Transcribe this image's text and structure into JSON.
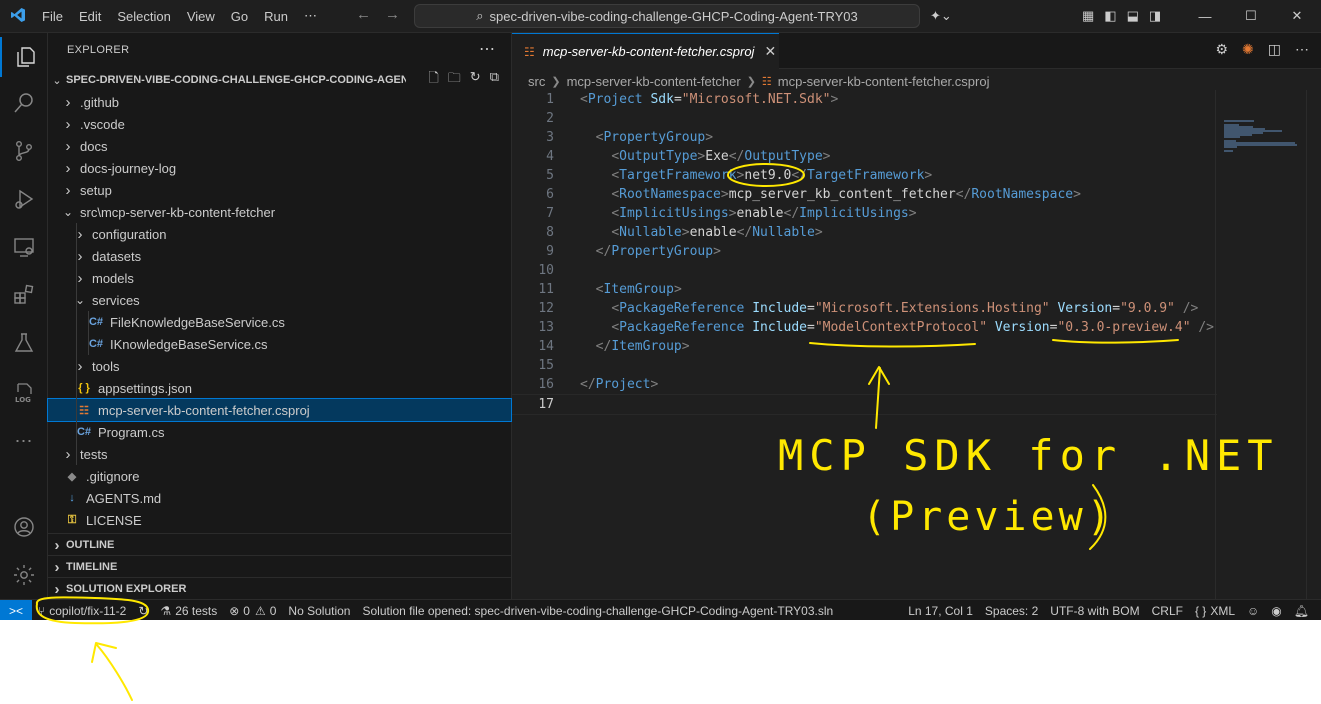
{
  "window": {
    "menu": [
      "File",
      "Edit",
      "Selection",
      "View",
      "Go",
      "Run",
      "⋯"
    ],
    "search": "spec-driven-vibe-coding-challenge-GHCP-Coding-Agent-TRY03"
  },
  "sidebar": {
    "title": "EXPLORER",
    "root": "SPEC-DRIVEN-VIBE-CODING-CHALLENGE-GHCP-CODING-AGEN...",
    "tree": [
      {
        "label": ".github",
        "kind": "folder",
        "indent": 0
      },
      {
        "label": ".vscode",
        "kind": "folder",
        "indent": 0
      },
      {
        "label": "docs",
        "kind": "folder",
        "indent": 0
      },
      {
        "label": "docs-journey-log",
        "kind": "folder",
        "indent": 0
      },
      {
        "label": "setup",
        "kind": "folder",
        "indent": 0
      },
      {
        "label": "src\\mcp-server-kb-content-fetcher",
        "kind": "folder-open",
        "indent": 0
      },
      {
        "label": "configuration",
        "kind": "folder",
        "indent": 1
      },
      {
        "label": "datasets",
        "kind": "folder",
        "indent": 1
      },
      {
        "label": "models",
        "kind": "folder",
        "indent": 1
      },
      {
        "label": "services",
        "kind": "folder-open",
        "indent": 1
      },
      {
        "label": "FileKnowledgeBaseService.cs",
        "kind": "cs",
        "indent": 2
      },
      {
        "label": "IKnowledgeBaseService.cs",
        "kind": "cs",
        "indent": 2
      },
      {
        "label": "tools",
        "kind": "folder",
        "indent": 1
      },
      {
        "label": "appsettings.json",
        "kind": "json",
        "indent": 1
      },
      {
        "label": "mcp-server-kb-content-fetcher.csproj",
        "kind": "rss",
        "indent": 1,
        "selected": true
      },
      {
        "label": "Program.cs",
        "kind": "cs",
        "indent": 1
      },
      {
        "label": "tests",
        "kind": "folder",
        "indent": 0
      },
      {
        "label": ".gitignore",
        "kind": "git",
        "indent": 0
      },
      {
        "label": "AGENTS.md",
        "kind": "md",
        "indent": 0
      },
      {
        "label": "LICENSE",
        "kind": "license",
        "indent": 0
      }
    ],
    "sections": [
      "OUTLINE",
      "TIMELINE",
      "SOLUTION EXPLORER"
    ]
  },
  "editor": {
    "tab": "mcp-server-kb-content-fetcher.csproj",
    "breadcrumbs": [
      "src",
      "mcp-server-kb-content-fetcher",
      "mcp-server-kb-content-fetcher.csproj"
    ],
    "cursor_line": 17,
    "lines": [
      [
        [
          "b",
          "<"
        ],
        [
          "tag",
          "Project"
        ],
        [
          "txt",
          " "
        ],
        [
          "attr",
          "Sdk"
        ],
        [
          "txt",
          "="
        ],
        [
          "str",
          "\"Microsoft.NET.Sdk\""
        ],
        [
          "b",
          ">"
        ]
      ],
      [],
      [
        [
          "txt",
          "  "
        ],
        [
          "b",
          "<"
        ],
        [
          "tag",
          "PropertyGroup"
        ],
        [
          "b",
          ">"
        ]
      ],
      [
        [
          "txt",
          "    "
        ],
        [
          "b",
          "<"
        ],
        [
          "tag",
          "OutputType"
        ],
        [
          "b",
          ">"
        ],
        [
          "txt",
          "Exe"
        ],
        [
          "b",
          "</"
        ],
        [
          "tag",
          "OutputType"
        ],
        [
          "b",
          ">"
        ]
      ],
      [
        [
          "txt",
          "    "
        ],
        [
          "b",
          "<"
        ],
        [
          "tag",
          "TargetFramework"
        ],
        [
          "b",
          ">"
        ],
        [
          "txt",
          "net9.0"
        ],
        [
          "b",
          "</"
        ],
        [
          "tag",
          "TargetFramework"
        ],
        [
          "b",
          ">"
        ]
      ],
      [
        [
          "txt",
          "    "
        ],
        [
          "b",
          "<"
        ],
        [
          "tag",
          "RootNamespace"
        ],
        [
          "b",
          ">"
        ],
        [
          "txt",
          "mcp_server_kb_content_fetcher"
        ],
        [
          "b",
          "</"
        ],
        [
          "tag",
          "RootNamespace"
        ],
        [
          "b",
          ">"
        ]
      ],
      [
        [
          "txt",
          "    "
        ],
        [
          "b",
          "<"
        ],
        [
          "tag",
          "ImplicitUsings"
        ],
        [
          "b",
          ">"
        ],
        [
          "txt",
          "enable"
        ],
        [
          "b",
          "</"
        ],
        [
          "tag",
          "ImplicitUsings"
        ],
        [
          "b",
          ">"
        ]
      ],
      [
        [
          "txt",
          "    "
        ],
        [
          "b",
          "<"
        ],
        [
          "tag",
          "Nullable"
        ],
        [
          "b",
          ">"
        ],
        [
          "txt",
          "enable"
        ],
        [
          "b",
          "</"
        ],
        [
          "tag",
          "Nullable"
        ],
        [
          "b",
          ">"
        ]
      ],
      [
        [
          "txt",
          "  "
        ],
        [
          "b",
          "</"
        ],
        [
          "tag",
          "PropertyGroup"
        ],
        [
          "b",
          ">"
        ]
      ],
      [],
      [
        [
          "txt",
          "  "
        ],
        [
          "b",
          "<"
        ],
        [
          "tag",
          "ItemGroup"
        ],
        [
          "b",
          ">"
        ]
      ],
      [
        [
          "txt",
          "    "
        ],
        [
          "b",
          "<"
        ],
        [
          "tag",
          "PackageReference"
        ],
        [
          "txt",
          " "
        ],
        [
          "attr",
          "Include"
        ],
        [
          "txt",
          "="
        ],
        [
          "str",
          "\"Microsoft.Extensions.Hosting\""
        ],
        [
          "txt",
          " "
        ],
        [
          "attr",
          "Version"
        ],
        [
          "txt",
          "="
        ],
        [
          "str",
          "\"9.0.9\""
        ],
        [
          "txt",
          " "
        ],
        [
          "b",
          "/>"
        ]
      ],
      [
        [
          "txt",
          "    "
        ],
        [
          "b",
          "<"
        ],
        [
          "tag",
          "PackageReference"
        ],
        [
          "txt",
          " "
        ],
        [
          "attr",
          "Include"
        ],
        [
          "txt",
          "="
        ],
        [
          "str",
          "\"ModelContextProtocol\""
        ],
        [
          "txt",
          " "
        ],
        [
          "attr",
          "Version"
        ],
        [
          "txt",
          "="
        ],
        [
          "str",
          "\"0.3.0-preview.4\""
        ],
        [
          "txt",
          " "
        ],
        [
          "b",
          "/>"
        ]
      ],
      [
        [
          "txt",
          "  "
        ],
        [
          "b",
          "</"
        ],
        [
          "tag",
          "ItemGroup"
        ],
        [
          "b",
          ">"
        ]
      ],
      [],
      [
        [
          "b",
          "</"
        ],
        [
          "tag",
          "Project"
        ],
        [
          "b",
          ">"
        ]
      ],
      []
    ]
  },
  "statusbar": {
    "branch": "copilot/fix-11-2",
    "tests": "26 tests",
    "errors": "0",
    "warnings": "0",
    "solution": "No Solution",
    "message": "Solution file opened: spec-driven-vibe-coding-challenge-GHCP-Coding-Agent-TRY03.sln",
    "position": "Ln 17, Col 1",
    "spaces": "Spaces: 2",
    "encoding": "UTF-8 with BOM",
    "eol": "CRLF",
    "language": "XML"
  },
  "annotations": {
    "ink_color": "#ffe800",
    "note_line1": "MCP SDK for .NET",
    "note_line2": "(Preview)"
  }
}
